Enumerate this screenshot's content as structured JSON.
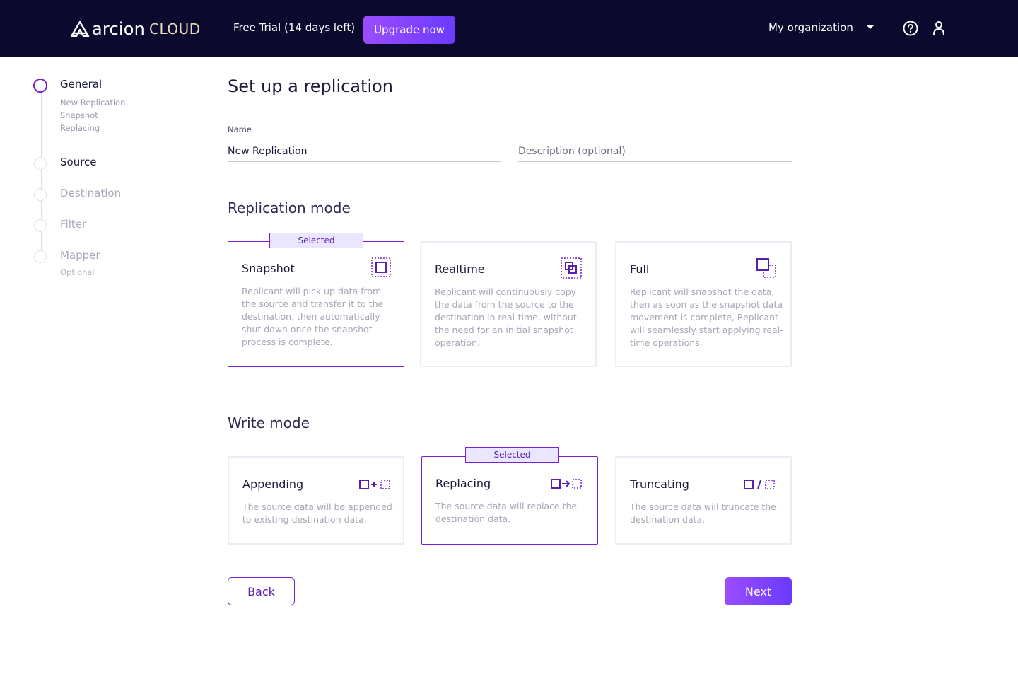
{
  "header": {
    "logo_word": "arcion",
    "logo_cloud": "CLOUD",
    "trial_text": "Free Trial (14 days left)",
    "upgrade_label": "Upgrade now",
    "organization": "My organization"
  },
  "stepper": {
    "steps": [
      {
        "label": "General",
        "subs": [
          "New Replication",
          "Snapshot",
          "Replacing"
        ],
        "state": "active"
      },
      {
        "label": "Source",
        "state": "pending"
      },
      {
        "label": "Destination",
        "state": "disabled"
      },
      {
        "label": "Filter",
        "state": "disabled"
      },
      {
        "label": "Mapper",
        "subs": [
          "Optional"
        ],
        "state": "disabled"
      }
    ]
  },
  "main": {
    "title": "Set up a replication",
    "name_label": "Name",
    "name_value": "New Replication",
    "description_placeholder": "Description (optional)",
    "replication_mode_title": "Replication mode",
    "write_mode_title": "Write mode",
    "selected_badge": "Selected",
    "replication_modes": [
      {
        "title": "Snapshot",
        "desc_lines": [
          "Replicant will pick up data from",
          "the source and transfer it to the",
          "destination, then automatically",
          "shut down once the snapshot",
          "process is complete."
        ],
        "selected": true,
        "icon": "snapshot-icon"
      },
      {
        "title": "Realtime",
        "desc_lines": [
          "Replicant will continuously copy",
          "the data from the source to the",
          "destination in real-time, without",
          "the need for an initial snapshot",
          "operation."
        ],
        "selected": false,
        "icon": "realtime-icon"
      },
      {
        "title": "Full",
        "desc_lines": [
          "Replicant will snapshot the data,",
          "then as soon as the snapshot data",
          "movement is complete, Replicant",
          "will seamlessly start applying real-",
          "time operations."
        ],
        "selected": false,
        "icon": "full-icon"
      }
    ],
    "write_modes": [
      {
        "title": "Appending",
        "desc_lines": [
          "The source data will be appended",
          "to existing destination data."
        ],
        "selected": false,
        "icon": "append-icon"
      },
      {
        "title": "Replacing",
        "desc_lines": [
          "The source data will replace the",
          "destination data."
        ],
        "selected": true,
        "icon": "replace-icon"
      },
      {
        "title": "Truncating",
        "desc_lines": [
          "The source data will truncate the",
          "destination data."
        ],
        "selected": false,
        "icon": "truncate-icon"
      }
    ],
    "back_label": "Back",
    "next_label": "Next"
  },
  "colors": {
    "header_bg": "#0b0a2e",
    "accent": "#7a1fd1",
    "button_gradient_start": "#9b4dff",
    "button_gradient_end": "#6a3bff",
    "badge_bg": "#ebe6ff"
  }
}
